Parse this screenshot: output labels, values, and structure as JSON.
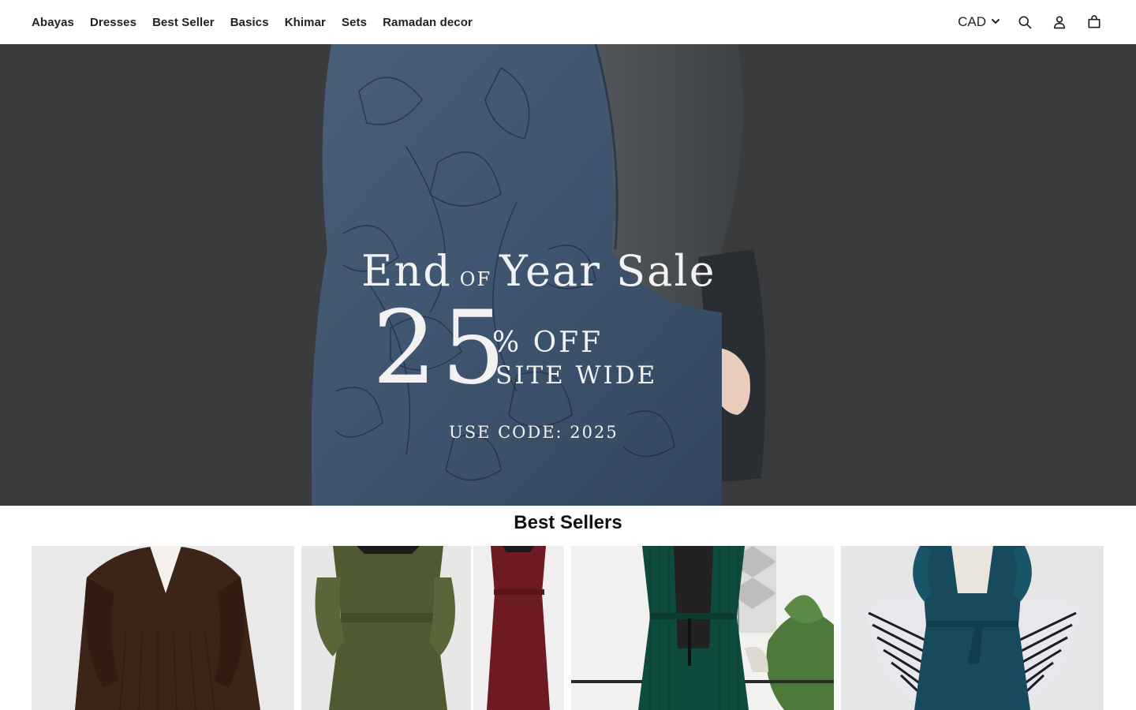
{
  "nav": {
    "items": [
      "Abayas",
      "Dresses",
      "Best Seller",
      "Basics",
      "Khimar",
      "Sets",
      "Ramadan decor"
    ]
  },
  "header": {
    "currency": "CAD",
    "icons": [
      "search-icon",
      "account-icon",
      "cart-icon"
    ]
  },
  "hero": {
    "title_part1": "End",
    "title_of": "OF",
    "title_part2": "Year Sale",
    "discount": "25",
    "off": "% OFF",
    "site_wide": "SITE WIDE",
    "code": "USE CODE: 2025",
    "background_color": "#3a3b3d"
  },
  "best_sellers": {
    "title": "Best Sellers",
    "products": [
      {
        "color": "#3d2418"
      },
      {
        "color": "#4f5a33"
      },
      {
        "color": "#0f4a3e"
      },
      {
        "color": "#164a5c"
      }
    ]
  }
}
